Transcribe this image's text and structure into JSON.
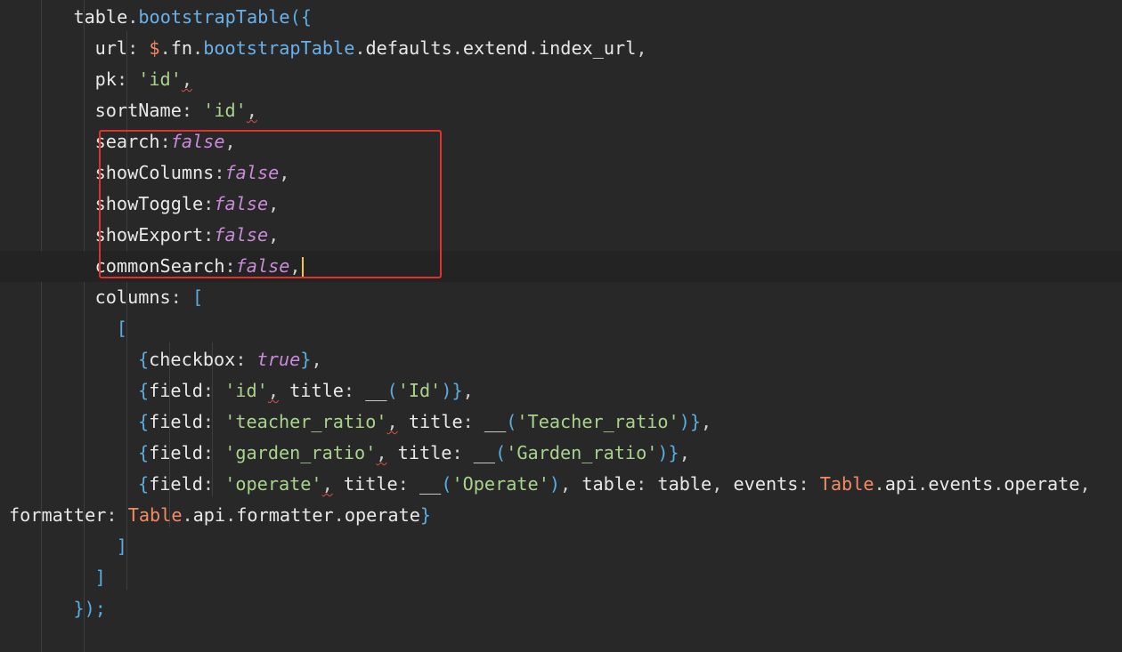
{
  "editor": {
    "colors": {
      "background": "#282828",
      "current_line": "#232323",
      "keyword_method": "#6ab0e9",
      "class_name": "#f28b64",
      "string": "#a8d38c",
      "boolean": "#c98bd9",
      "bracket": "#58aee0",
      "highlight_box": "#e0322c",
      "cursor": "#f5c542"
    },
    "lines": [
      {
        "indent": 6,
        "tokens": [
          {
            "t": "table",
            "c": "plain"
          },
          {
            "t": ".",
            "c": "punct"
          },
          {
            "t": "bootstrapTable",
            "c": "method"
          },
          {
            "t": "({",
            "c": "bracket"
          }
        ]
      },
      {
        "indent": 8,
        "tokens": [
          {
            "t": "url",
            "c": "plain"
          },
          {
            "t": ": ",
            "c": "punct"
          },
          {
            "t": "$",
            "c": "class"
          },
          {
            "t": ".",
            "c": "punct"
          },
          {
            "t": "fn",
            "c": "plain"
          },
          {
            "t": ".",
            "c": "punct"
          },
          {
            "t": "bootstrapTable",
            "c": "method"
          },
          {
            "t": ".",
            "c": "punct"
          },
          {
            "t": "defaults",
            "c": "plain"
          },
          {
            "t": ".",
            "c": "punct"
          },
          {
            "t": "extend",
            "c": "plain"
          },
          {
            "t": ".",
            "c": "punct"
          },
          {
            "t": "index_url",
            "c": "plain"
          },
          {
            "t": ",",
            "c": "punct"
          }
        ]
      },
      {
        "indent": 8,
        "tokens": [
          {
            "t": "pk",
            "c": "plain"
          },
          {
            "t": ": ",
            "c": "punct"
          },
          {
            "t": "'id'",
            "c": "string"
          },
          {
            "t": ",",
            "c": "punct",
            "squiggle": true
          }
        ]
      },
      {
        "indent": 8,
        "tokens": [
          {
            "t": "sortName",
            "c": "plain"
          },
          {
            "t": ": ",
            "c": "punct"
          },
          {
            "t": "'id'",
            "c": "string"
          },
          {
            "t": ",",
            "c": "punct",
            "squiggle": true
          }
        ]
      },
      {
        "indent": 8,
        "tokens": [
          {
            "t": "search",
            "c": "plain"
          },
          {
            "t": ":",
            "c": "punct"
          },
          {
            "t": "false",
            "c": "bool"
          },
          {
            "t": ",",
            "c": "punct"
          }
        ]
      },
      {
        "indent": 8,
        "tokens": [
          {
            "t": "showColumns",
            "c": "plain"
          },
          {
            "t": ":",
            "c": "punct"
          },
          {
            "t": "false",
            "c": "bool"
          },
          {
            "t": ",",
            "c": "punct"
          }
        ]
      },
      {
        "indent": 8,
        "tokens": [
          {
            "t": "showToggle",
            "c": "plain"
          },
          {
            "t": ":",
            "c": "punct"
          },
          {
            "t": "false",
            "c": "bool"
          },
          {
            "t": ",",
            "c": "punct"
          }
        ]
      },
      {
        "indent": 8,
        "tokens": [
          {
            "t": "showExport",
            "c": "plain"
          },
          {
            "t": ":",
            "c": "punct"
          },
          {
            "t": "false",
            "c": "bool"
          },
          {
            "t": ",",
            "c": "punct"
          }
        ]
      },
      {
        "indent": 8,
        "current": true,
        "cursor": true,
        "tokens": [
          {
            "t": "commonSearch",
            "c": "plain"
          },
          {
            "t": ":",
            "c": "punct"
          },
          {
            "t": "false",
            "c": "bool"
          },
          {
            "t": ",",
            "c": "punct"
          }
        ]
      },
      {
        "indent": 8,
        "tokens": [
          {
            "t": "columns",
            "c": "plain"
          },
          {
            "t": ": ",
            "c": "punct"
          },
          {
            "t": "[",
            "c": "bracket"
          }
        ]
      },
      {
        "indent": 10,
        "tokens": [
          {
            "t": "[",
            "c": "bracket"
          }
        ]
      },
      {
        "indent": 12,
        "tokens": [
          {
            "t": "{",
            "c": "bracket"
          },
          {
            "t": "checkbox",
            "c": "plain"
          },
          {
            "t": ": ",
            "c": "punct"
          },
          {
            "t": "true",
            "c": "bool"
          },
          {
            "t": "}",
            "c": "bracket"
          },
          {
            "t": ",",
            "c": "punct"
          }
        ]
      },
      {
        "indent": 12,
        "tokens": [
          {
            "t": "{",
            "c": "bracket"
          },
          {
            "t": "field",
            "c": "plain"
          },
          {
            "t": ": ",
            "c": "punct"
          },
          {
            "t": "'id'",
            "c": "string"
          },
          {
            "t": ",",
            "c": "punct",
            "squiggle": true
          },
          {
            "t": " title",
            "c": "plain"
          },
          {
            "t": ": ",
            "c": "punct"
          },
          {
            "t": "__",
            "c": "plain"
          },
          {
            "t": "(",
            "c": "bracket"
          },
          {
            "t": "'Id'",
            "c": "string"
          },
          {
            "t": ")",
            "c": "bracket"
          },
          {
            "t": "}",
            "c": "bracket"
          },
          {
            "t": ",",
            "c": "punct"
          }
        ]
      },
      {
        "indent": 12,
        "tokens": [
          {
            "t": "{",
            "c": "bracket"
          },
          {
            "t": "field",
            "c": "plain"
          },
          {
            "t": ": ",
            "c": "punct"
          },
          {
            "t": "'teacher_ratio'",
            "c": "string"
          },
          {
            "t": ",",
            "c": "punct",
            "squiggle": true
          },
          {
            "t": " title",
            "c": "plain"
          },
          {
            "t": ": ",
            "c": "punct"
          },
          {
            "t": "__",
            "c": "plain"
          },
          {
            "t": "(",
            "c": "bracket"
          },
          {
            "t": "'Teacher_ratio'",
            "c": "string"
          },
          {
            "t": ")",
            "c": "bracket"
          },
          {
            "t": "}",
            "c": "bracket"
          },
          {
            "t": ",",
            "c": "punct"
          }
        ]
      },
      {
        "indent": 12,
        "tokens": [
          {
            "t": "{",
            "c": "bracket"
          },
          {
            "t": "field",
            "c": "plain"
          },
          {
            "t": ": ",
            "c": "punct"
          },
          {
            "t": "'garden_ratio'",
            "c": "string"
          },
          {
            "t": ",",
            "c": "punct",
            "squiggle": true
          },
          {
            "t": " title",
            "c": "plain"
          },
          {
            "t": ": ",
            "c": "punct"
          },
          {
            "t": "__",
            "c": "plain"
          },
          {
            "t": "(",
            "c": "bracket"
          },
          {
            "t": "'Garden_ratio'",
            "c": "string"
          },
          {
            "t": ")",
            "c": "bracket"
          },
          {
            "t": "}",
            "c": "bracket"
          },
          {
            "t": ",",
            "c": "punct"
          }
        ]
      },
      {
        "indent": 12,
        "tokens": [
          {
            "t": "{",
            "c": "bracket"
          },
          {
            "t": "field",
            "c": "plain"
          },
          {
            "t": ": ",
            "c": "punct"
          },
          {
            "t": "'operate'",
            "c": "string"
          },
          {
            "t": ",",
            "c": "punct",
            "squiggle": true
          },
          {
            "t": " title",
            "c": "plain"
          },
          {
            "t": ": ",
            "c": "punct"
          },
          {
            "t": "__",
            "c": "plain"
          },
          {
            "t": "(",
            "c": "bracket"
          },
          {
            "t": "'Operate'",
            "c": "string"
          },
          {
            "t": ")",
            "c": "bracket"
          },
          {
            "t": ",",
            "c": "punct"
          },
          {
            "t": " table",
            "c": "plain"
          },
          {
            "t": ": ",
            "c": "punct"
          },
          {
            "t": "table",
            "c": "plain"
          },
          {
            "t": ",",
            "c": "punct"
          },
          {
            "t": " events",
            "c": "plain"
          },
          {
            "t": ": ",
            "c": "punct"
          },
          {
            "t": "Table",
            "c": "class"
          },
          {
            "t": ".",
            "c": "punct"
          },
          {
            "t": "api",
            "c": "plain"
          },
          {
            "t": ".",
            "c": "punct"
          },
          {
            "t": "events",
            "c": "plain"
          },
          {
            "t": ".",
            "c": "punct"
          },
          {
            "t": "operate",
            "c": "plain"
          },
          {
            "t": ",",
            "c": "punct"
          }
        ]
      },
      {
        "indent": 0,
        "tokens": [
          {
            "t": "formatter",
            "c": "plain"
          },
          {
            "t": ": ",
            "c": "punct"
          },
          {
            "t": "Table",
            "c": "class"
          },
          {
            "t": ".",
            "c": "punct"
          },
          {
            "t": "api",
            "c": "plain"
          },
          {
            "t": ".",
            "c": "punct"
          },
          {
            "t": "formatter",
            "c": "plain"
          },
          {
            "t": ".",
            "c": "punct"
          },
          {
            "t": "operate",
            "c": "plain"
          },
          {
            "t": "}",
            "c": "bracket"
          }
        ]
      },
      {
        "indent": 10,
        "tokens": [
          {
            "t": "]",
            "c": "bracket"
          }
        ]
      },
      {
        "indent": 8,
        "tokens": [
          {
            "t": "]",
            "c": "bracket"
          }
        ]
      },
      {
        "indent": 6,
        "tokens": [
          {
            "t": "});",
            "c": "bracket"
          }
        ]
      }
    ]
  }
}
